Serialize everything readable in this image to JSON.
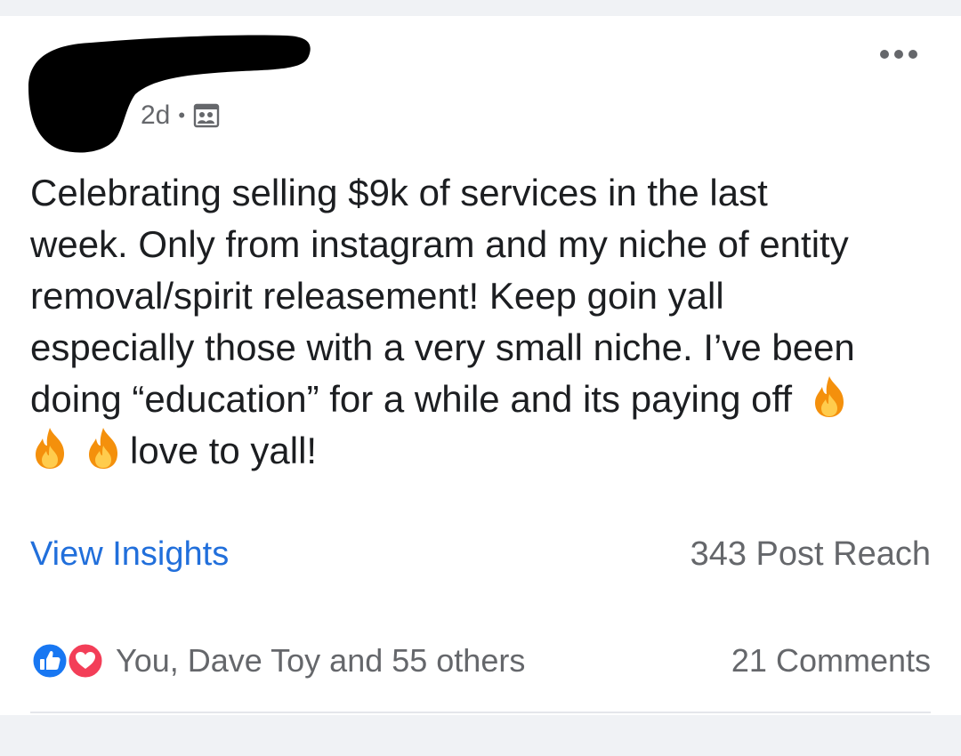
{
  "post": {
    "timestamp": "2d",
    "separator": "•",
    "audience_icon": "group-audience-icon",
    "more_icon": "more-options-icon",
    "text_lines": [
      "Celebrating selling $9k of services in the last",
      "week. Only from instagram and my niche of entity",
      "removal/spirit releasement! Keep goin yall",
      "especially those with a very small niche. I’ve been",
      "doing “education” for a while and its paying off"
    ],
    "text_end": "love to yall!",
    "emoji_icon": "fire-emoji-icon"
  },
  "insights": {
    "view_label": "View Insights",
    "reach_label": "343 Post Reach"
  },
  "reactions": {
    "icons": [
      "like-reaction-icon",
      "love-reaction-icon"
    ],
    "summary": "You, Dave Toy and 55 others",
    "comments": "21 Comments"
  },
  "colors": {
    "link_blue": "#216fdb",
    "secondary_text": "#65676b",
    "like_blue": "#1877f2",
    "love_red": "#f33e58"
  }
}
